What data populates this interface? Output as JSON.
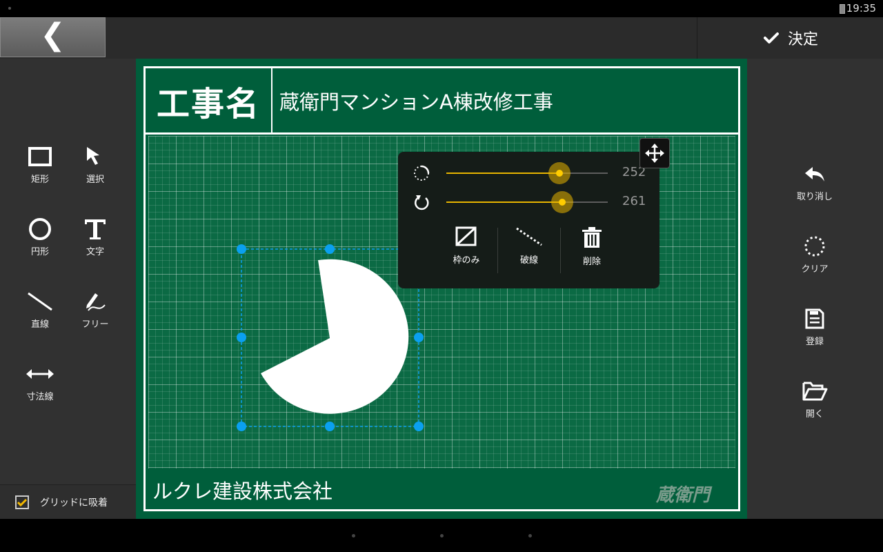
{
  "status_bar": {
    "time": "19:35"
  },
  "toolbar": {
    "back_glyph": "❮",
    "confirm_label": "決定"
  },
  "left_tools": [
    {
      "label": "矩形",
      "icon": "rectangle-icon"
    },
    {
      "label": "選択",
      "icon": "cursor-arrow-icon"
    },
    {
      "label": "円形",
      "icon": "circle-icon"
    },
    {
      "label": "文字",
      "icon": "text-T-icon"
    },
    {
      "label": "直線",
      "icon": "line-icon"
    },
    {
      "label": "フリー",
      "icon": "freehand-pen-icon"
    },
    {
      "label": "寸法線",
      "icon": "dimension-arrow-icon"
    }
  ],
  "grid_snap": {
    "label": "グリッドに吸着",
    "checked": true
  },
  "right_tools": [
    {
      "label": "取り消し",
      "icon": "undo-icon"
    },
    {
      "label": "クリア",
      "icon": "dotted-circle-icon"
    },
    {
      "label": "登録",
      "icon": "save-icon"
    },
    {
      "label": "開く",
      "icon": "open-folder-icon"
    }
  ],
  "board": {
    "title_label": "工事名",
    "title_value": "蔵衛門マンションA棟改修工事",
    "company": "ルクレ建設株式会社",
    "watermark": "蔵衛門"
  },
  "shape_popup": {
    "start_angle": {
      "value": "252",
      "fraction": 0.7
    },
    "sweep_angle": {
      "value": "261",
      "fraction": 0.72
    },
    "actions": [
      {
        "label": "枠のみ",
        "icon": "outline-only-icon"
      },
      {
        "label": "破線",
        "icon": "dashed-line-icon"
      },
      {
        "label": "削除",
        "icon": "trash-icon"
      }
    ]
  },
  "colors": {
    "board_green": "#005e3b",
    "grid_green": "#0b6a44",
    "selection_blue": "#0aa0f0",
    "slider_accent": "#e8b500",
    "panel_gray": "#313131"
  }
}
